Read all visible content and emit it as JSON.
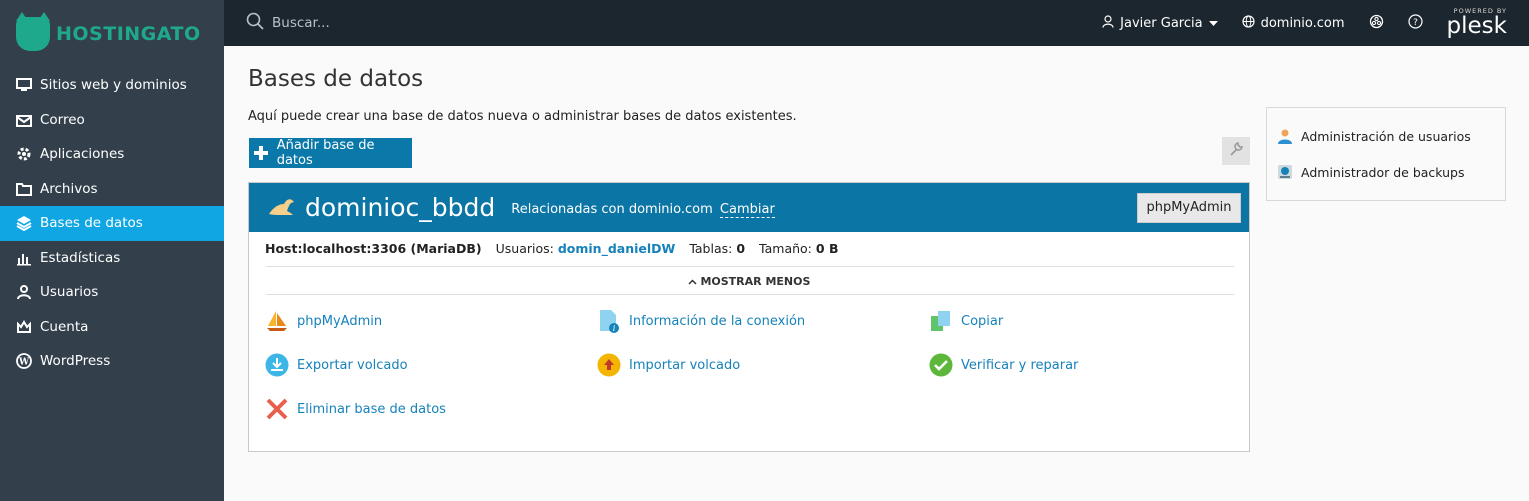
{
  "brand": {
    "name": "HOSTINGATO",
    "color": "#1fa98c"
  },
  "sidebar": {
    "items": [
      {
        "label": "Sitios web y dominios",
        "icon": "monitor-icon"
      },
      {
        "label": "Correo",
        "icon": "mail-icon"
      },
      {
        "label": "Aplicaciones",
        "icon": "gear-icon"
      },
      {
        "label": "Archivos",
        "icon": "folder-icon"
      },
      {
        "label": "Bases de datos",
        "icon": "database-icon",
        "active": true
      },
      {
        "label": "Estadísticas",
        "icon": "bar-chart-icon"
      },
      {
        "label": "Usuarios",
        "icon": "user-icon"
      },
      {
        "label": "Cuenta",
        "icon": "crown-icon"
      },
      {
        "label": "WordPress",
        "icon": "wordpress-icon"
      }
    ]
  },
  "topbar": {
    "search_placeholder": "Buscar...",
    "user": "Javier Garcia",
    "domain": "dominio.com",
    "powered_by": "POWERED BY",
    "plesk": "plesk"
  },
  "page": {
    "title": "Bases de datos",
    "description": "Aquí puede crear una base de datos nueva o administrar bases de datos existentes.",
    "add_button": "Añadir base de datos"
  },
  "database": {
    "name": "dominioc_bbdd",
    "related_prefix": "Relacionadas con dominio.com",
    "change_link": "Cambiar",
    "phpmyadmin_button": "phpMyAdmin",
    "host_label": "Host:",
    "host_value": "localhost:3306 (MariaDB)",
    "users_label": "Usuarios:",
    "users_value": "domin_danielDW",
    "tables_label": "Tablas:",
    "tables_value": "0",
    "size_label": "Tamaño:",
    "size_value": "0 B",
    "toggle_label": "MOSTRAR MENOS",
    "actions": {
      "phpmyadmin": "phpMyAdmin",
      "connection_info": "Información de la conexión",
      "copy": "Copiar",
      "export_dump": "Exportar volcado",
      "import_dump": "Importar volcado",
      "verify_repair": "Verificar y reparar",
      "delete": "Eliminar base de datos"
    }
  },
  "side_panel": {
    "users_admin": "Administración de usuarios",
    "backup_admin": "Administrador de backups"
  },
  "colors": {
    "sidebar_bg": "#33404c",
    "topbar_bg": "#1c262e",
    "accent": "#10a6e3",
    "db_header": "#0b76a5",
    "link": "#1682ba"
  }
}
